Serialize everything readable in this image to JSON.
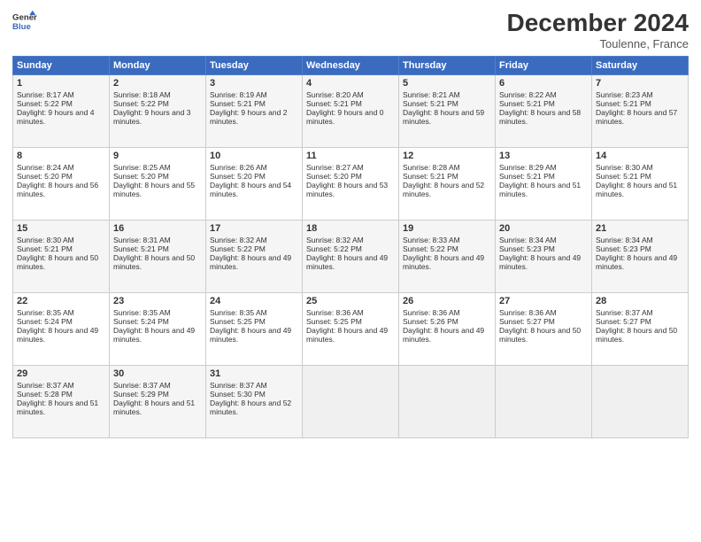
{
  "header": {
    "title": "December 2024",
    "location": "Toulenne, France",
    "logo_line1": "General",
    "logo_line2": "Blue"
  },
  "weekdays": [
    "Sunday",
    "Monday",
    "Tuesday",
    "Wednesday",
    "Thursday",
    "Friday",
    "Saturday"
  ],
  "weeks": [
    [
      {
        "day": "1",
        "rise": "8:17 AM",
        "set": "5:22 PM",
        "daylight": "9 hours and 4 minutes."
      },
      {
        "day": "2",
        "rise": "8:18 AM",
        "set": "5:22 PM",
        "daylight": "9 hours and 3 minutes."
      },
      {
        "day": "3",
        "rise": "8:19 AM",
        "set": "5:21 PM",
        "daylight": "9 hours and 2 minutes."
      },
      {
        "day": "4",
        "rise": "8:20 AM",
        "set": "5:21 PM",
        "daylight": "9 hours and 0 minutes."
      },
      {
        "day": "5",
        "rise": "8:21 AM",
        "set": "5:21 PM",
        "daylight": "8 hours and 59 minutes."
      },
      {
        "day": "6",
        "rise": "8:22 AM",
        "set": "5:21 PM",
        "daylight": "8 hours and 58 minutes."
      },
      {
        "day": "7",
        "rise": "8:23 AM",
        "set": "5:21 PM",
        "daylight": "8 hours and 57 minutes."
      }
    ],
    [
      {
        "day": "8",
        "rise": "8:24 AM",
        "set": "5:20 PM",
        "daylight": "8 hours and 56 minutes."
      },
      {
        "day": "9",
        "rise": "8:25 AM",
        "set": "5:20 PM",
        "daylight": "8 hours and 55 minutes."
      },
      {
        "day": "10",
        "rise": "8:26 AM",
        "set": "5:20 PM",
        "daylight": "8 hours and 54 minutes."
      },
      {
        "day": "11",
        "rise": "8:27 AM",
        "set": "5:20 PM",
        "daylight": "8 hours and 53 minutes."
      },
      {
        "day": "12",
        "rise": "8:28 AM",
        "set": "5:21 PM",
        "daylight": "8 hours and 52 minutes."
      },
      {
        "day": "13",
        "rise": "8:29 AM",
        "set": "5:21 PM",
        "daylight": "8 hours and 51 minutes."
      },
      {
        "day": "14",
        "rise": "8:30 AM",
        "set": "5:21 PM",
        "daylight": "8 hours and 51 minutes."
      }
    ],
    [
      {
        "day": "15",
        "rise": "8:30 AM",
        "set": "5:21 PM",
        "daylight": "8 hours and 50 minutes."
      },
      {
        "day": "16",
        "rise": "8:31 AM",
        "set": "5:21 PM",
        "daylight": "8 hours and 50 minutes."
      },
      {
        "day": "17",
        "rise": "8:32 AM",
        "set": "5:22 PM",
        "daylight": "8 hours and 49 minutes."
      },
      {
        "day": "18",
        "rise": "8:32 AM",
        "set": "5:22 PM",
        "daylight": "8 hours and 49 minutes."
      },
      {
        "day": "19",
        "rise": "8:33 AM",
        "set": "5:22 PM",
        "daylight": "8 hours and 49 minutes."
      },
      {
        "day": "20",
        "rise": "8:34 AM",
        "set": "5:23 PM",
        "daylight": "8 hours and 49 minutes."
      },
      {
        "day": "21",
        "rise": "8:34 AM",
        "set": "5:23 PM",
        "daylight": "8 hours and 49 minutes."
      }
    ],
    [
      {
        "day": "22",
        "rise": "8:35 AM",
        "set": "5:24 PM",
        "daylight": "8 hours and 49 minutes."
      },
      {
        "day": "23",
        "rise": "8:35 AM",
        "set": "5:24 PM",
        "daylight": "8 hours and 49 minutes."
      },
      {
        "day": "24",
        "rise": "8:35 AM",
        "set": "5:25 PM",
        "daylight": "8 hours and 49 minutes."
      },
      {
        "day": "25",
        "rise": "8:36 AM",
        "set": "5:25 PM",
        "daylight": "8 hours and 49 minutes."
      },
      {
        "day": "26",
        "rise": "8:36 AM",
        "set": "5:26 PM",
        "daylight": "8 hours and 49 minutes."
      },
      {
        "day": "27",
        "rise": "8:36 AM",
        "set": "5:27 PM",
        "daylight": "8 hours and 50 minutes."
      },
      {
        "day": "28",
        "rise": "8:37 AM",
        "set": "5:27 PM",
        "daylight": "8 hours and 50 minutes."
      }
    ],
    [
      {
        "day": "29",
        "rise": "8:37 AM",
        "set": "5:28 PM",
        "daylight": "8 hours and 51 minutes."
      },
      {
        "day": "30",
        "rise": "8:37 AM",
        "set": "5:29 PM",
        "daylight": "8 hours and 51 minutes."
      },
      {
        "day": "31",
        "rise": "8:37 AM",
        "set": "5:30 PM",
        "daylight": "8 hours and 52 minutes."
      },
      null,
      null,
      null,
      null
    ]
  ]
}
